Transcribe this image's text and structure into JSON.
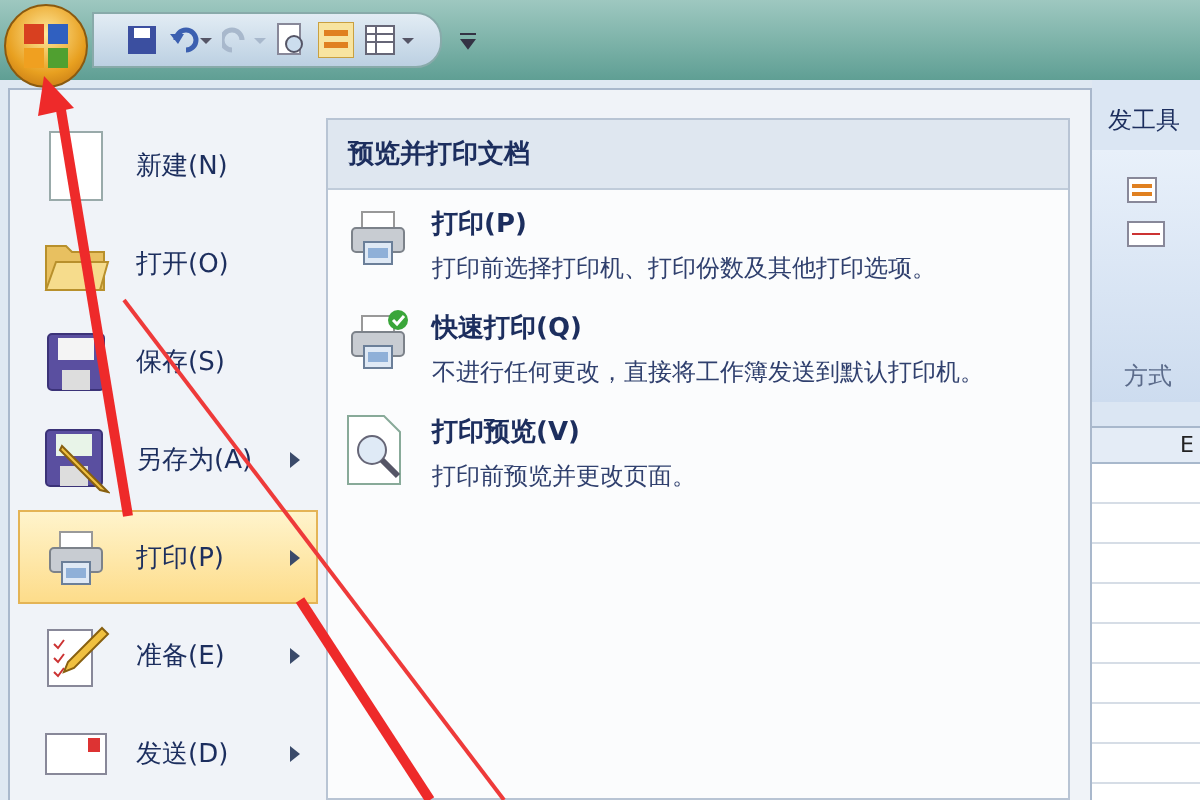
{
  "menu": {
    "items": [
      {
        "kind": "new",
        "label": "新建(N)",
        "submenu": false,
        "selected": false
      },
      {
        "kind": "open",
        "label": "打开(O)",
        "submenu": false,
        "selected": false
      },
      {
        "kind": "save",
        "label": "保存(S)",
        "submenu": false,
        "selected": false
      },
      {
        "kind": "saveas",
        "label": "另存为(A)",
        "submenu": true,
        "selected": false
      },
      {
        "kind": "print",
        "label": "打印(P)",
        "submenu": true,
        "selected": true
      },
      {
        "kind": "prepare",
        "label": "准备(E)",
        "submenu": true,
        "selected": false
      },
      {
        "kind": "send",
        "label": "发送(D)",
        "submenu": true,
        "selected": false
      }
    ]
  },
  "submenu": {
    "title": "预览并打印文档",
    "items": [
      {
        "kind": "print",
        "title": "打印(P)",
        "description": "打印前选择打印机、打印份数及其他打印选项。"
      },
      {
        "kind": "quickprint",
        "title": "快速打印(Q)",
        "description": "不进行任何更改，直接将工作簿发送到默认打印机。"
      },
      {
        "kind": "preview",
        "title": "打印预览(V)",
        "description": "打印前预览并更改页面。"
      }
    ]
  },
  "ribbon": {
    "tab": "发工具",
    "group_label": "方式",
    "column_header": "E"
  }
}
